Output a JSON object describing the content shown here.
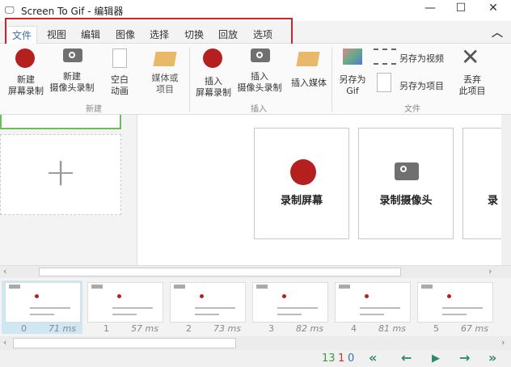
{
  "window": {
    "title": "Screen To Gif - 编辑器",
    "minimize": "—",
    "maximize": "☐",
    "close": "✕"
  },
  "tabs": [
    "文件",
    "视图",
    "编辑",
    "图像",
    "选择",
    "切换",
    "回放",
    "选项"
  ],
  "ribbon": {
    "groups": {
      "new": "新建",
      "insert": "插入",
      "file": "文件"
    },
    "new_screen": [
      "新建",
      "屏幕录制"
    ],
    "new_camera": [
      "新建",
      "摄像头录制"
    ],
    "blank": [
      "空白",
      "动画"
    ],
    "media": [
      "媒体或",
      "项目"
    ],
    "ins_screen": [
      "插入",
      "屏幕录制"
    ],
    "ins_camera": [
      "插入",
      "摄像头录制"
    ],
    "ins_media": "插入媒体",
    "save_gif": [
      "另存为",
      "Gif"
    ],
    "save_video": "另存为视频",
    "save_project": "另存为项目",
    "discard": [
      "丢弃",
      "此项目"
    ],
    "collapse": "︿"
  },
  "cards": [
    "录制屏幕",
    "录制摄像头",
    "录"
  ],
  "frames": [
    {
      "n": "0",
      "ms": "71 ms"
    },
    {
      "n": "1",
      "ms": "57 ms"
    },
    {
      "n": "2",
      "ms": "73 ms"
    },
    {
      "n": "3",
      "ms": "82 ms"
    },
    {
      "n": "4",
      "ms": "81 ms"
    },
    {
      "n": "5",
      "ms": "67 ms"
    }
  ],
  "status": {
    "total": "13",
    "selected": "1",
    "current": "0"
  }
}
